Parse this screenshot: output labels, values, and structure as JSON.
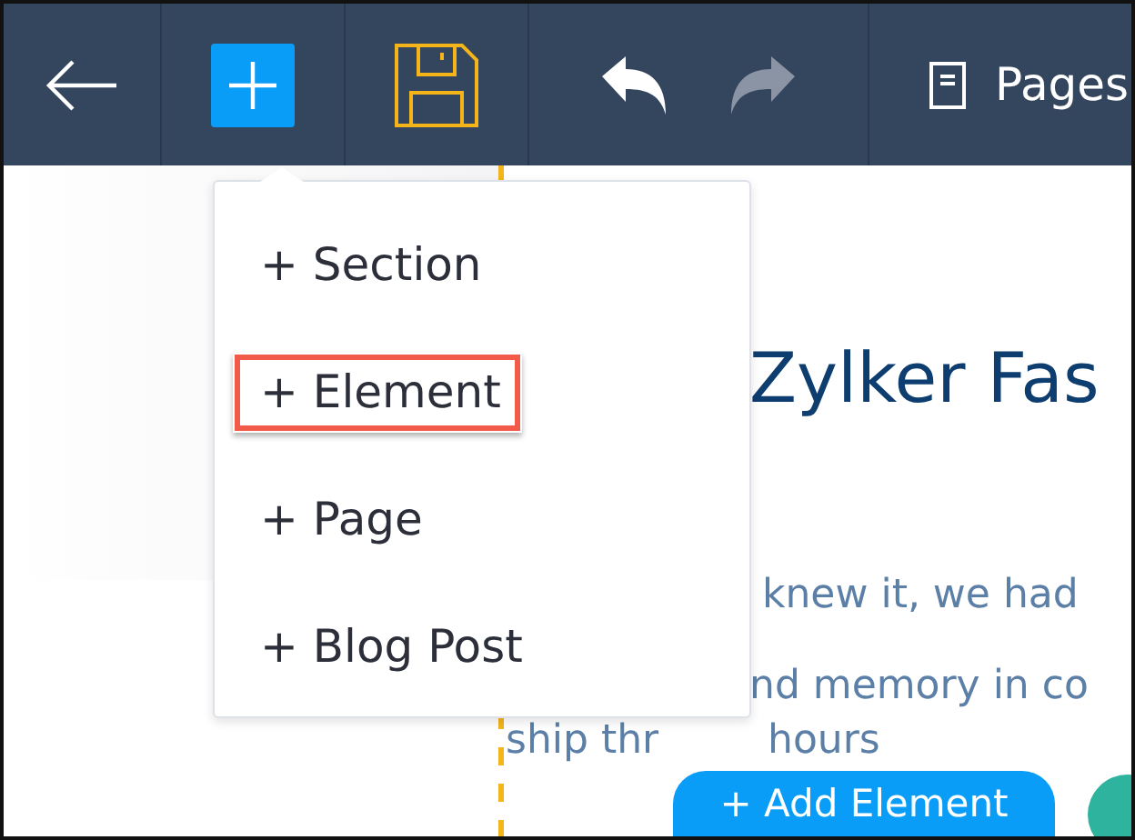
{
  "toolbar": {
    "pages_label": "Pages",
    "redo_disabled": true
  },
  "add_menu": {
    "items": [
      {
        "label": "+ Section",
        "highlighted": false
      },
      {
        "label": "+ Element",
        "highlighted": true
      },
      {
        "label": "+ Page",
        "highlighted": false
      },
      {
        "label": "+ Blog Post",
        "highlighted": false
      }
    ]
  },
  "page": {
    "heading": "Zylker Fas",
    "paragraph_lines": [
      "knew it, we had",
      "nd memory in co",
      "ship thr"
    ],
    "paragraph_tail": "hours",
    "add_element_button": "+ Add Element"
  }
}
